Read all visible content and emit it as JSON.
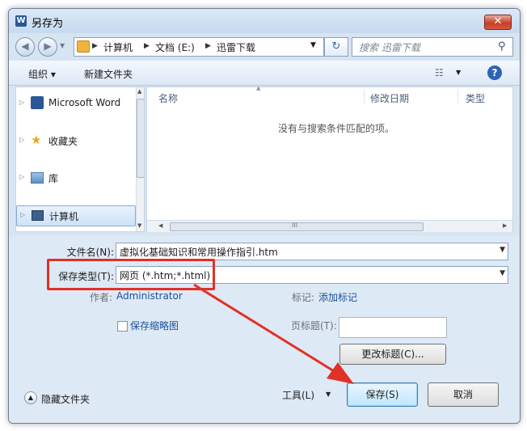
{
  "window": {
    "title": "另存为",
    "app_icon_letter": "W",
    "close_glyph": "✕"
  },
  "nav": {
    "back_glyph": "◀",
    "forward_glyph": "▶",
    "path": [
      "计算机",
      "文档 (E:)",
      "迅雷下载"
    ],
    "refresh_glyph": "↻",
    "search_placeholder": "搜索 迅雷下载"
  },
  "toolbar": {
    "organize_label": "组织 ▾",
    "new_folder_label": "新建文件夹",
    "help_glyph": "?"
  },
  "sidebar": {
    "items": [
      {
        "label": "Microsoft Word",
        "icon": "word-icon",
        "selected": false
      },
      {
        "label": "收藏夹",
        "icon": "star-icon",
        "selected": false
      },
      {
        "label": "库",
        "icon": "library-icon",
        "selected": false
      },
      {
        "label": "计算机",
        "icon": "computer-icon",
        "selected": true
      }
    ]
  },
  "filelist": {
    "columns": [
      "名称",
      "修改日期",
      "类型"
    ],
    "empty_message": "没有与搜索条件匹配的项。",
    "grip_glyph": "III"
  },
  "form": {
    "filename_label": "文件名(N):",
    "filename_value": "虚拟化基础知识和常用操作指引.htm",
    "savetype_label": "保存类型(T):",
    "savetype_value": "网页 (*.htm;*.html)",
    "author_label": "作者:",
    "author_value": "Administrator",
    "tags_label": "标记:",
    "tags_value": "添加标记",
    "thumbnail_label": "保存缩略图",
    "page_title_label": "页标题(T):",
    "change_title_button": "更改标题(C)..."
  },
  "footer": {
    "hide_folders": "隐藏文件夹",
    "tools_label": "工具(L)",
    "save_button": "保存(S)",
    "cancel_button": "取消"
  },
  "colors": {
    "annotation_red": "#e03126",
    "accent_blue": "#1f4f9c"
  }
}
